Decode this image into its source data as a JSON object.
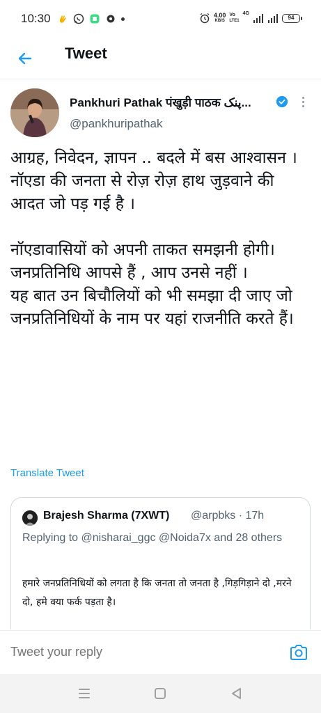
{
  "status_bar": {
    "time": "10:30",
    "net_speed_value": "4.00",
    "net_speed_unit": "KB/S",
    "volte_top": "Vo",
    "volte_bottom": "LTE1",
    "network_label": "4G",
    "battery": "94"
  },
  "app_bar": {
    "title": "Tweet",
    "back_icon": "arrow-left-icon"
  },
  "tweet": {
    "user_name": "Pankhuri Pathak पंखुड़ी पाठक پنک...",
    "handle": "@pankhuripathak",
    "verified": true,
    "text": "आग्रह, निवेदन, ज्ञापन .. बदले में बस आश्वासन ।\nनॉएडा की जनता से रोज़ रोज़ हाथ जुड़वाने की आदत जो पड़ गई है ।\n\nनॉएडावासियों को अपनी ताकत समझनी होगी।\nजनप्रतिनिधि आपसे हैं , आप उनसे नहीं ।\nयह बात उन बिचौलियों को भी समझा दी जाए जो जनप्रतिनिधियों के नाम पर यहां राजनीति करते हैं।",
    "translate_label": "Translate Tweet"
  },
  "quoted_tweet": {
    "name": "Brajesh Sharma (7XWT)",
    "handle_time": "@arpbks · 17h",
    "replying_to": "Replying to @nisharai_ggc @Noida7x and 28 others",
    "text": "हमारे जनप्रतिनिधियों को लगता है कि जनता तो जनता है ,गिड़गिड़ाने दो ,मरने दो, हमे क्या फर्क  पड़ता है।"
  },
  "reply": {
    "placeholder": "Tweet your reply"
  },
  "colors": {
    "accent": "#1d9bf0",
    "text_primary": "#0f1419",
    "text_secondary": "#536471"
  },
  "icons": {
    "back": "arrow-left-icon",
    "verified": "verified-badge-icon",
    "more": "more-vertical-icon",
    "camera": "camera-icon",
    "nav_menu": "recent-apps-icon",
    "nav_home": "home-icon",
    "nav_back": "back-triangle-icon"
  }
}
